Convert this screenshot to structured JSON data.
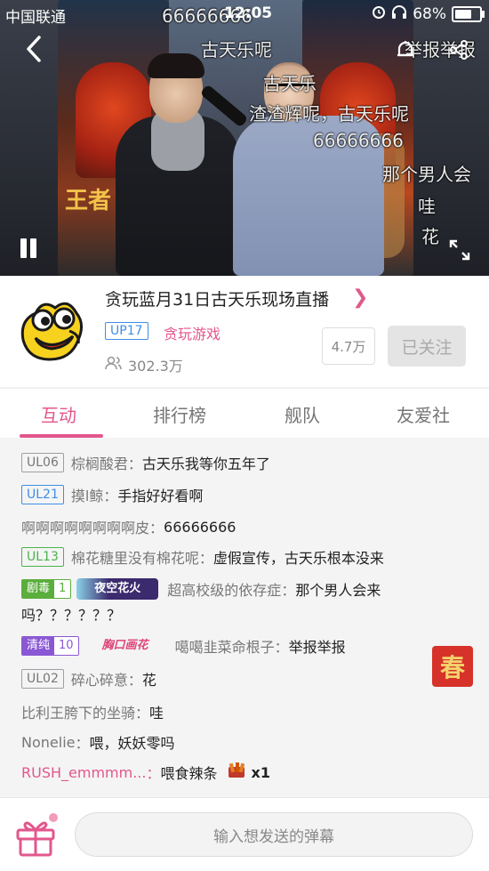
{
  "status_bar": {
    "carrier": "中国联通",
    "time": "12:05",
    "battery": "68%"
  },
  "video": {
    "poster_text": "王者",
    "danmaku": [
      "66666666",
      "古天乐呢",
      "古天乐",
      "渣渣辉呢，古天乐呢",
      "66666666",
      "那个男人会",
      "哇",
      "举报举报",
      "花"
    ]
  },
  "room": {
    "title": "贪玩蓝月31日古天乐现场直播",
    "up_level": "UP17",
    "category": "贪玩游戏",
    "viewers": "302.3万",
    "fans": "4.7万",
    "follow_label": "已关注"
  },
  "tabs": [
    "互动",
    "排行榜",
    "舰队",
    "友爱社"
  ],
  "chat": [
    {
      "level": "UL06",
      "user": "棕榈酸君",
      "text": "古天乐我等你五年了"
    },
    {
      "level": "UL21",
      "user": "摸l鲸",
      "text": "手指好好看啊"
    },
    {
      "user": "啊啊啊啊啊啊啊啊皮",
      "text": "66666666"
    },
    {
      "level": "UL13",
      "user": "棉花糖里没有棉花呢",
      "text": "虚假宣传，古天乐根本没来"
    },
    {
      "medal_name": "剧毒",
      "medal_level": "1",
      "badge": "夜空花火",
      "user": "超高校级的依存症",
      "text": "那个男人会来",
      "text_cont": "吗？？？？？？"
    },
    {
      "medal_name": "清纯",
      "medal_level": "10",
      "badge": "胸口画花",
      "user": "噶噶韭菜命根子",
      "text": "举报举报"
    },
    {
      "level": "UL02",
      "user": "碎心碎意",
      "text": "花"
    },
    {
      "user": "比利王胯下的坐骑",
      "text": "哇"
    },
    {
      "user": "Nonelie",
      "text": "喂，妖妖零吗"
    },
    {
      "user": "RUSH_emmmm...",
      "text": "喂食辣条",
      "count": "x1"
    }
  ],
  "spring_badge": "春",
  "input": {
    "placeholder": "输入想发送的弹幕"
  },
  "colors": {
    "accent": "#e2578c",
    "blue": "#3d8ee8",
    "green": "#4bb34b"
  }
}
